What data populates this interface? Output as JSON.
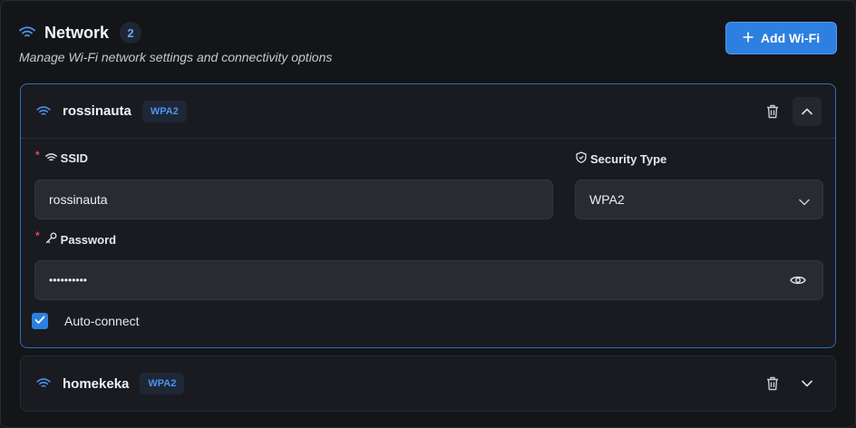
{
  "header": {
    "title": "Network",
    "count": "2",
    "subtitle": "Manage Wi-Fi network settings and connectivity options",
    "add_button_label": "Add Wi-Fi"
  },
  "networks": [
    {
      "name": "rossinauta",
      "security_badge": "WPA2",
      "expanded": true,
      "ssid_label": "SSID",
      "ssid_value": "rossinauta",
      "security_label": "Security Type",
      "security_value": "WPA2",
      "password_label": "Password",
      "password_masked": "••••••••••",
      "autoconnect_label": "Auto-connect",
      "autoconnect_checked": true
    },
    {
      "name": "homekeka",
      "security_badge": "WPA2",
      "expanded": false
    }
  ],
  "colors": {
    "accent": "#2d7fe0",
    "badge_text": "#4e92eb",
    "required": "#e5484d",
    "background": "#141519"
  },
  "icons": {
    "wifi": "wifi-icon",
    "delete": "trash-icon",
    "collapse": "chevron-up-icon",
    "expand": "chevron-down-icon",
    "security": "shield-icon",
    "password": "key-icon",
    "reveal": "eye-icon",
    "add": "plus-icon",
    "check": "check-icon"
  }
}
